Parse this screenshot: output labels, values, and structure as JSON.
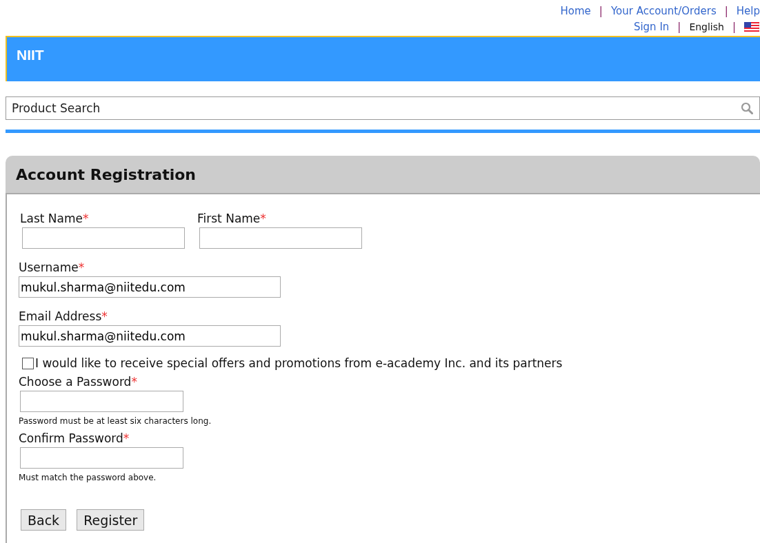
{
  "top_links": [
    [
      {
        "kind": "link",
        "text": "Home"
      },
      {
        "kind": "separator",
        "text": "|"
      },
      {
        "kind": "link",
        "text": "Your Account/Orders"
      },
      {
        "kind": "separator",
        "text": "|"
      },
      {
        "kind": "link",
        "text": "Help"
      }
    ],
    [
      {
        "kind": "link",
        "text": "Sign In"
      },
      {
        "kind": "separator",
        "text": "|"
      },
      {
        "kind": "text",
        "text": "English"
      },
      {
        "kind": "separator",
        "text": "|"
      },
      {
        "kind": "flag"
      }
    ]
  ],
  "banner": {
    "title": "NIIT"
  },
  "search": {
    "placeholder": "Product Search"
  },
  "panel": {
    "title": "Account Registration"
  },
  "name_fields": [
    {
      "label": "Last Name",
      "required_mark": "*"
    },
    {
      "label": "First Name",
      "required_mark": "*"
    }
  ],
  "fields": [
    {
      "kind": "text",
      "label": "Username",
      "required_mark": "*",
      "value": "mukul.sharma@niitedu.com"
    },
    {
      "kind": "text",
      "label": "Email Address",
      "required_mark": "*",
      "value": "mukul.sharma@niitedu.com"
    },
    {
      "kind": "checkbox",
      "label": "I would like to receive special offers and promotions from e-academy Inc. and its partners",
      "checked": false
    },
    {
      "kind": "password",
      "label": "Choose a Password",
      "required_mark": "*",
      "hint": "Password must be at least six characters long."
    },
    {
      "kind": "password",
      "label": "Confirm Password",
      "required_mark": "*",
      "hint": "Must match the password above."
    }
  ],
  "buttons": [
    "Back",
    "Register"
  ]
}
